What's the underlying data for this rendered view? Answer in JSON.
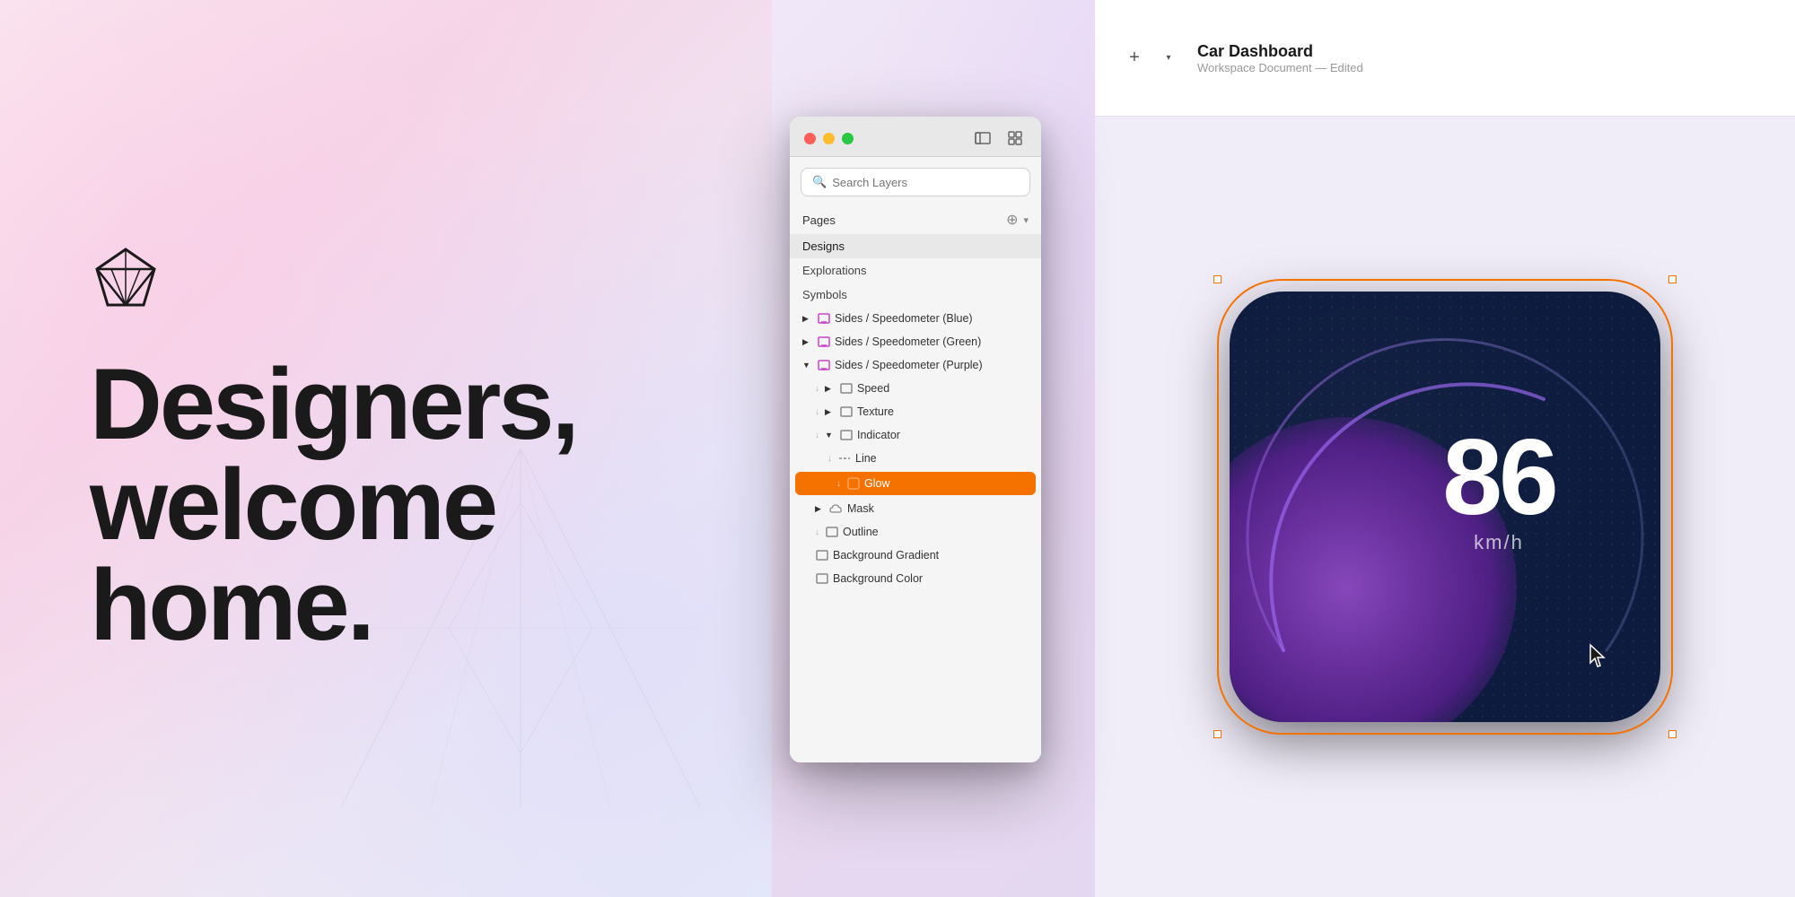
{
  "hero": {
    "headline_line1": "Designers,",
    "headline_line2": "welcome",
    "headline_line3": "home."
  },
  "window": {
    "search_placeholder": "Search Layers",
    "pages_label": "Pages",
    "pages": [
      {
        "id": "designs",
        "label": "Designs",
        "active": true
      },
      {
        "id": "explorations",
        "label": "Explorations",
        "active": false
      },
      {
        "id": "symbols",
        "label": "Symbols",
        "active": false
      }
    ],
    "layers": [
      {
        "id": "sides-blue",
        "label": "Sides / Speedometer (Blue)",
        "indent": 0,
        "type": "symbol",
        "collapsed": true
      },
      {
        "id": "sides-green",
        "label": "Sides / Speedometer (Green)",
        "indent": 0,
        "type": "symbol",
        "collapsed": true
      },
      {
        "id": "sides-purple",
        "label": "Sides / Speedometer (Purple)",
        "indent": 0,
        "type": "symbol",
        "collapsed": false
      },
      {
        "id": "speed",
        "label": "Speed",
        "indent": 1,
        "type": "group",
        "collapsed": true
      },
      {
        "id": "texture",
        "label": "Texture",
        "indent": 1,
        "type": "group",
        "collapsed": true
      },
      {
        "id": "indicator",
        "label": "Indicator",
        "indent": 1,
        "type": "group",
        "collapsed": false
      },
      {
        "id": "line",
        "label": "Line",
        "indent": 2,
        "type": "line"
      },
      {
        "id": "glow",
        "label": "Glow",
        "indent": 2,
        "type": "glow",
        "selected": true
      },
      {
        "id": "mask",
        "label": "Mask",
        "indent": 1,
        "type": "cloud",
        "collapsed": true
      },
      {
        "id": "outline",
        "label": "Outline",
        "indent": 1,
        "type": "rect"
      },
      {
        "id": "bg-gradient",
        "label": "Background Gradient",
        "indent": 1,
        "type": "rect"
      },
      {
        "id": "bg-color",
        "label": "Background Color",
        "indent": 1,
        "type": "rect-empty"
      }
    ]
  },
  "header": {
    "title": "Car Dashboard",
    "subtitle": "Workspace Document — Edited",
    "add_label": "+",
    "dropdown_label": "▾"
  },
  "canvas": {
    "speedometer": {
      "value": "86",
      "unit": "km/h"
    }
  }
}
